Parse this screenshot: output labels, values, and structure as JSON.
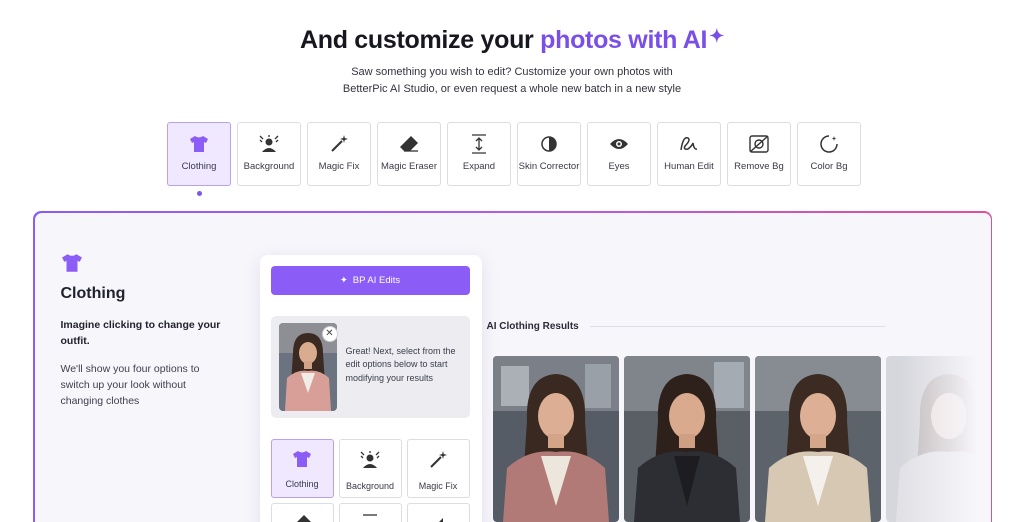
{
  "hero": {
    "title_plain": "And customize your ",
    "title_accent": "photos with AI",
    "subtitle_line1": "Saw something you wish to edit? Customize your own photos with",
    "subtitle_line2": "BetterPic AI Studio, or even request a whole new batch in a new style"
  },
  "tools": [
    {
      "label": "Clothing",
      "icon": "shirt-icon",
      "active": true
    },
    {
      "label": "Background",
      "icon": "background-icon"
    },
    {
      "label": "Magic Fix",
      "icon": "magic-wand-icon"
    },
    {
      "label": "Magic Eraser",
      "icon": "eraser-icon"
    },
    {
      "label": "Expand",
      "icon": "expand-icon"
    },
    {
      "label": "Skin Corrector",
      "icon": "contrast-icon"
    },
    {
      "label": "Eyes",
      "icon": "eye-icon"
    },
    {
      "label": "Human Edit",
      "icon": "squiggle-icon"
    },
    {
      "label": "Remove Bg",
      "icon": "remove-bg-icon"
    },
    {
      "label": "Color Bg",
      "icon": "color-bg-icon"
    }
  ],
  "feature": {
    "title": "Clothing",
    "lead": "Imagine clicking to change your outfit.",
    "desc": "We'll show you four options to switch up your look without changing clothes"
  },
  "editor": {
    "button_label": "BP AI Edits",
    "message": "Great! Next, select from the edit options below to start modifying your results",
    "close_symbol": "✕",
    "mini_tools": [
      {
        "label": "Clothing",
        "active": true
      },
      {
        "label": "Background"
      },
      {
        "label": "Magic Fix"
      }
    ]
  },
  "results": {
    "title": "AI Clothing Results",
    "photos": [
      {
        "outfit": "pink-blazer",
        "color": "#b77d78"
      },
      {
        "outfit": "black-blazer",
        "color": "#2f2f33"
      },
      {
        "outfit": "beige-blazer",
        "color": "#d9cbb8"
      },
      {
        "outfit": "faded",
        "color": "#c9c9c9"
      }
    ]
  },
  "colors": {
    "accent": "#7a4fe8",
    "button": "#8b5cf6",
    "active_tile_bg": "#efe8ff"
  }
}
